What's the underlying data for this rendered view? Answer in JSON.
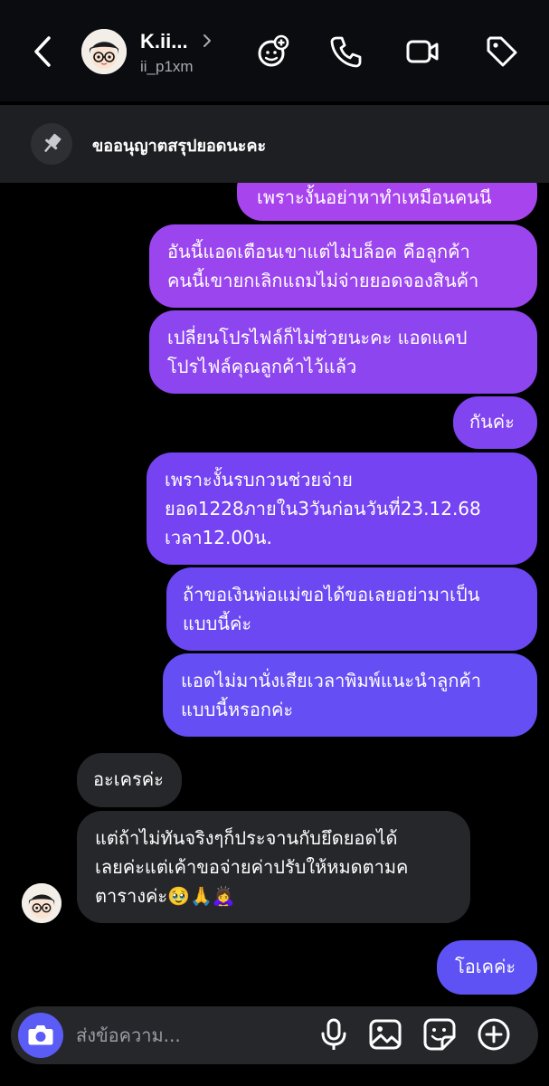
{
  "header": {
    "name": "K.ii...",
    "handle": "ii_p1xm",
    "icons": [
      "back-icon",
      "chevron-right-icon",
      "effects-icon",
      "phone-icon",
      "video-icon",
      "tag-icon"
    ]
  },
  "pinned": {
    "icon": "pin-icon",
    "text": "ขออนุญาตสรุปยอดนะคะ"
  },
  "messages": [
    {
      "dir": "out",
      "text": "เพราะงั้นอย่าหาทำเหมือนคนนี"
    },
    {
      "dir": "out",
      "text": "อันนี้แอดเตือนเขาแต่ไม่บล็อค คือลูกค้า\nคนนี้เขายกเลิกแถมไม่จ่ายยอดจองสินค้า"
    },
    {
      "dir": "out",
      "text": "เปลี่ยนโปรไฟล์ก็ไม่ช่วยนะคะ แอดแคป\nโปรไฟล์คุณลูกค้าไว้แล้ว"
    },
    {
      "dir": "out",
      "text": "กันค่ะ"
    },
    {
      "dir": "out",
      "text": "เพราะงั้นรบกวนช่วยจ่าย\nยอด1228ภายใน3วันก่อนวันที่23.12.68\nเวลา12.00น."
    },
    {
      "dir": "out",
      "text": "ถ้าขอเงินพ่อแม่ขอได้ขอเลยอย่ามาเป็น\nแบบนี้ค่ะ"
    },
    {
      "dir": "out",
      "text": "แอดไม่มานั่งเสียเวลาพิมพ์แนะนำลูกค้า\nแบบนี้หรอกค่ะ"
    },
    {
      "dir": "in",
      "text": "อะเครค่ะ"
    },
    {
      "dir": "in",
      "text": "แต่ถ้าไม่ทันจริงๆก็ประจานกับยึดยอดได้\nเลยค่ะแต่เค้าขอจ่ายค่าปรับให้หมดตามค\nตารางค่ะ🥹🙏🙇‍♀️"
    },
    {
      "dir": "out",
      "text": "โอเคค่ะ"
    }
  ],
  "composer": {
    "placeholder": "ส่งข้อความ...",
    "icons": [
      "camera-icon",
      "microphone-icon",
      "gallery-icon",
      "sticker-icon",
      "plus-icon"
    ]
  },
  "colors": {
    "background": "#000000",
    "incoming_bubble": "#26272b",
    "outgoing_top": "#a546ee",
    "outgoing_bottom": "#5e52f4",
    "accent": "#5b5cf6"
  }
}
